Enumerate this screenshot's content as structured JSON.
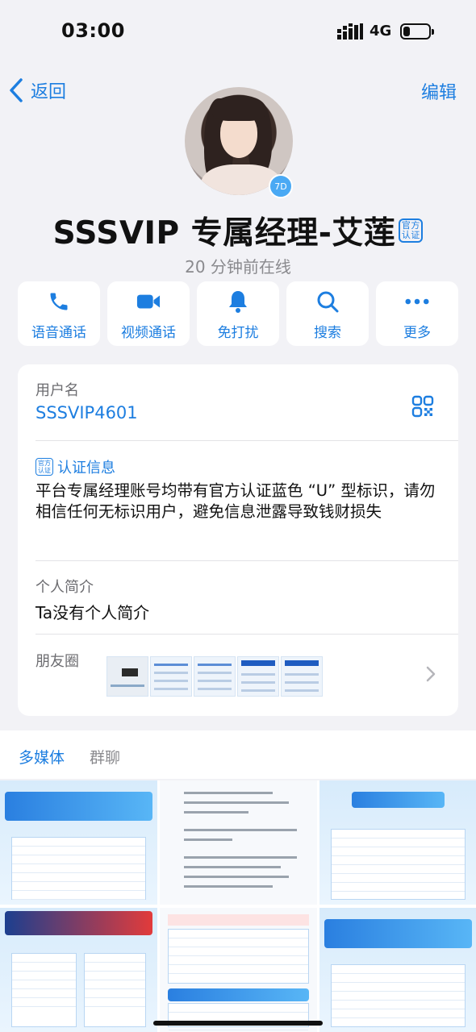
{
  "status_bar": {
    "time": "03:00",
    "network": "4G",
    "battery_level": 0.25
  },
  "nav": {
    "back_label": "返回",
    "edit_label": "编辑"
  },
  "profile": {
    "avatar_badge": "7D",
    "name": "SSSVIP 专属经理-艾莲",
    "official_badge": "官方认证",
    "last_seen": "20 分钟前在线"
  },
  "actions": [
    {
      "label": "语音通话",
      "icon": "phone-icon"
    },
    {
      "label": "视频通话",
      "icon": "video-icon"
    },
    {
      "label": "免打扰",
      "icon": "bell-icon"
    },
    {
      "label": "搜索",
      "icon": "search-icon"
    },
    {
      "label": "更多",
      "icon": "more-icon"
    }
  ],
  "info": {
    "username_label": "用户名",
    "username_value": "SSSVIP4601",
    "cert_badge": "官方认证",
    "cert_title": "认证信息",
    "cert_text": "平台专属经理账号均带有官方认证蓝色 “U” 型标识，请勿相信任何无标识用户，避免信息泄露导致钱财损失",
    "bio_label": "个人简介",
    "bio_value": "Ta没有个人简介",
    "moments_label": "朋友圈"
  },
  "tabs": {
    "media": "多媒体",
    "groups": "群聊"
  },
  "colors": {
    "accent": "#1d7ee0",
    "background": "#f2f2f6",
    "secondary_text": "#8a8a8e"
  }
}
